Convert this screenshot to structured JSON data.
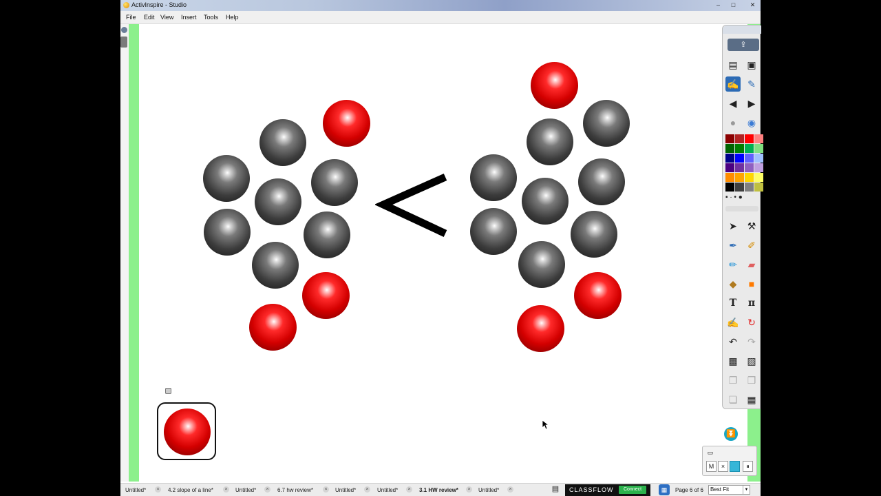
{
  "window": {
    "title": "ActivInspire - Studio"
  },
  "menu": {
    "items": [
      "File",
      "Edit",
      "View",
      "Insert",
      "Tools",
      "Help"
    ]
  },
  "canvas": {
    "comparison_symbol": "<"
  },
  "tabs": [
    {
      "label": "Untitled*",
      "active": false
    },
    {
      "label": "4.2 slope of a line*",
      "active": false
    },
    {
      "label": "Untitled*",
      "active": false
    },
    {
      "label": "6.7 hw review*",
      "active": false
    },
    {
      "label": "Untitled*",
      "active": false
    },
    {
      "label": "Untitled*",
      "active": false
    },
    {
      "label": "3.1 HW review*",
      "active": true
    },
    {
      "label": "Untitled*",
      "active": false
    }
  ],
  "status": {
    "classflow": "CLASSFLOW",
    "connect": "Connect",
    "page": "Page 6 of 6",
    "zoom": "Best Fit"
  },
  "recorder": {
    "buttons": [
      "M",
      "×",
      "",
      "⏸"
    ]
  },
  "colors": {
    "palette": [
      "#8b0000",
      "#b22222",
      "#ff0000",
      "#ff8080",
      "#006400",
      "#008000",
      "#00b050",
      "#80e080",
      "#00008b",
      "#0000ff",
      "#6060ff",
      "#a0c0ff",
      "#4b0082",
      "#7030a0",
      "#9060c0",
      "#c0a0e0",
      "#ff8c00",
      "#ffa500",
      "#ffd700",
      "#ffff66",
      "#000000",
      "#404040",
      "#808080",
      "#c0c040"
    ]
  }
}
